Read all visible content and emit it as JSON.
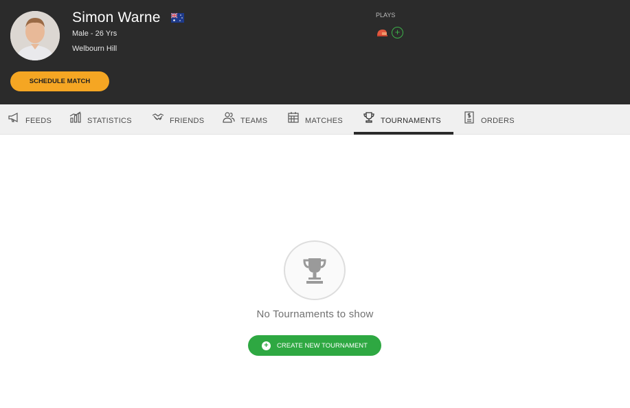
{
  "profile": {
    "name": "Simon Warne",
    "flag_icon": "australia-flag-icon",
    "meta": "Male - 26 Yrs",
    "location": "Welbourn Hill",
    "schedule_label": "SCHEDULE MATCH",
    "plays_label": "PLAYS",
    "sport_icon": "cricket-icon",
    "add_sport_icon": "plus-circle-icon"
  },
  "tabs": [
    {
      "label": "FEEDS",
      "icon": "megaphone-icon"
    },
    {
      "label": "STATISTICS",
      "icon": "chart-icon"
    },
    {
      "label": "FRIENDS",
      "icon": "handshake-icon"
    },
    {
      "label": "TEAMS",
      "icon": "users-icon"
    },
    {
      "label": "MATCHES",
      "icon": "calendar-icon"
    },
    {
      "label": "TOURNAMENTS",
      "icon": "trophy-icon",
      "active": true
    },
    {
      "label": "ORDERS",
      "icon": "receipt-icon"
    }
  ],
  "empty_state": {
    "icon": "trophy-icon",
    "message": "No Tournaments to show",
    "button_label": "CREATE NEW TOURNAMENT"
  },
  "colors": {
    "header_bg": "#2b2b2b",
    "accent_orange": "#f5a623",
    "accent_green": "#2ea842"
  }
}
